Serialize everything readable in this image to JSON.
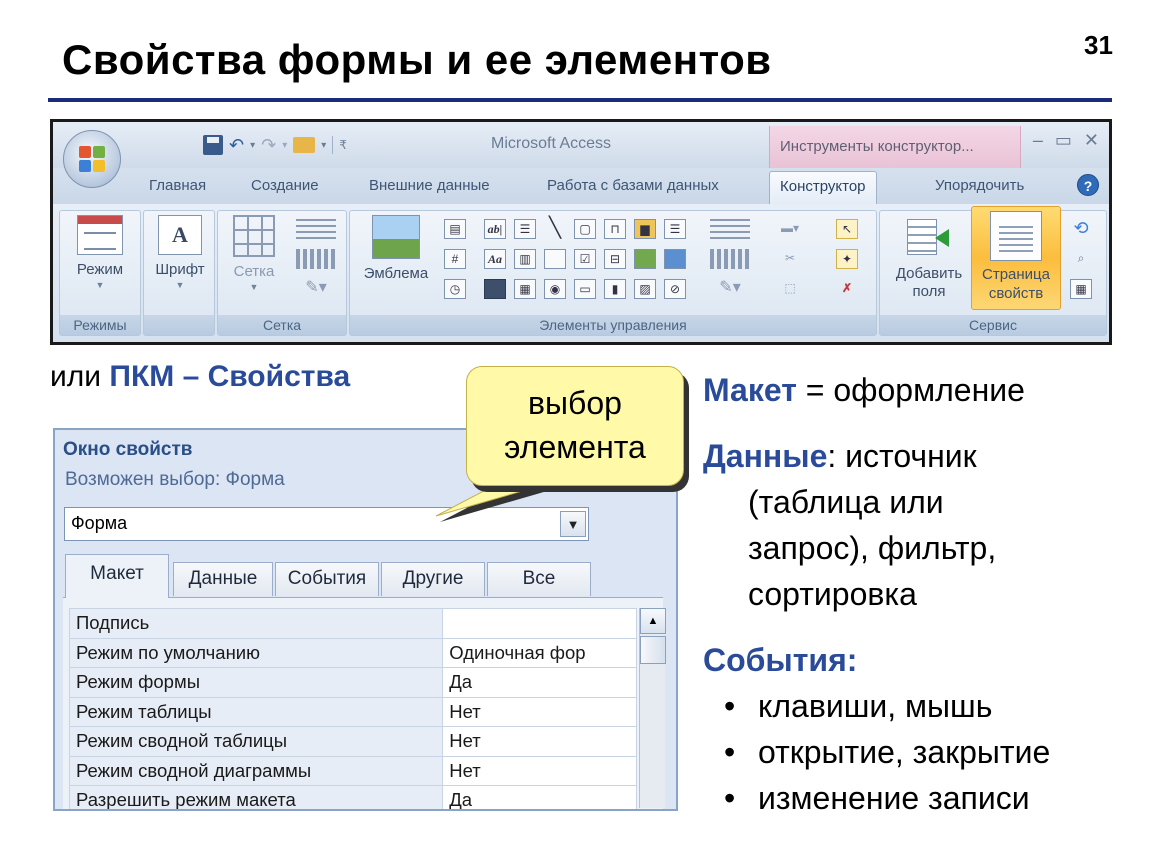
{
  "slide": {
    "title": "Свойства формы и ее элементов",
    "page_number": "31"
  },
  "ribbon": {
    "app_title": "Microsoft Access",
    "context_tools": "Инструменты конструктор...",
    "tabs": [
      "Главная",
      "Создание",
      "Внешние данные",
      "Работа с базами данных",
      "Конструктор",
      "Упорядочить"
    ],
    "active_tab": "Конструктор",
    "groups": {
      "modes": {
        "label": "Режимы",
        "button": "Режим"
      },
      "font": {
        "button": "Шрифт"
      },
      "grid": {
        "label": "Сетка",
        "button": "Сетка"
      },
      "controls": {
        "label": "Элементы управления",
        "logo_button": "Эмблема"
      },
      "service": {
        "label": "Сервис",
        "add_fields_line1": "Добавить",
        "add_fields_line2": "поля",
        "props_line1": "Страница",
        "props_line2": "свойств"
      }
    }
  },
  "pkm": {
    "prefix": "или",
    "highlight": "ПКМ – Свойства"
  },
  "callout": {
    "line1": "выбор",
    "line2": "элемента"
  },
  "property_sheet": {
    "title": "Окно свойств",
    "selection_label": "Возможен выбор:",
    "selection_type": "Форма",
    "selected_object": "Форма",
    "tabs": [
      "Макет",
      "Данные",
      "События",
      "Другие",
      "Все"
    ],
    "active_tab": "Макет",
    "rows": [
      {
        "name": "Подпись",
        "value": ""
      },
      {
        "name": "Режим по умолчанию",
        "value": "Одиночная фор"
      },
      {
        "name": "Режим формы",
        "value": "Да"
      },
      {
        "name": "Режим таблицы",
        "value": "Нет"
      },
      {
        "name": "Режим сводной таблицы",
        "value": "Нет"
      },
      {
        "name": "Режим сводной диаграммы",
        "value": "Нет"
      },
      {
        "name": "Разрешить режим макета",
        "value": "Да"
      }
    ]
  },
  "notes": {
    "layout_kw": "Макет",
    "layout_text": " = оформление",
    "data_kw": "Данные",
    "data_line1": ": источник",
    "data_line2": "(таблица или",
    "data_line3": "запрос), фильтр,",
    "data_line4": "сортировка",
    "events_kw": "События:",
    "bullets": [
      "клавиши, мышь",
      "открытие, закрытие",
      "изменение записи"
    ]
  },
  "colors": {
    "accent": "#2a4b9a",
    "title_rule": "#1c2a7a",
    "callout_fill": "#fff9a8",
    "ribbon_highlight": "#fbbd3d"
  }
}
